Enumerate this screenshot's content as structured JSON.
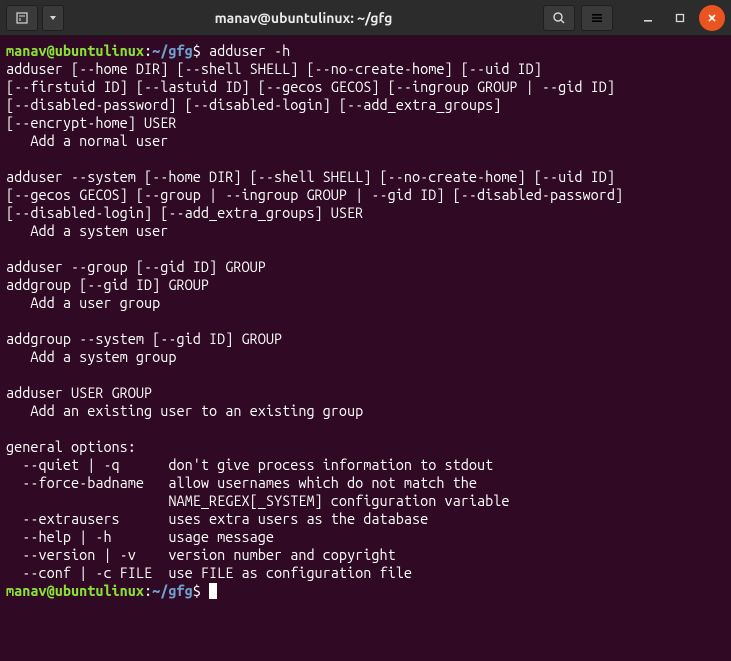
{
  "titlebar": {
    "title": "manav@ubuntulinux: ~/gfg"
  },
  "prompt": {
    "user": "manav@ubuntulinux",
    "sep": ":",
    "path": "~/gfg",
    "dollar": "$"
  },
  "command": "adduser -h",
  "output": [
    "adduser [--home DIR] [--shell SHELL] [--no-create-home] [--uid ID]",
    "[--firstuid ID] [--lastuid ID] [--gecos GECOS] [--ingroup GROUP | --gid ID]",
    "[--disabled-password] [--disabled-login] [--add_extra_groups]",
    "[--encrypt-home] USER",
    "   Add a normal user",
    "",
    "adduser --system [--home DIR] [--shell SHELL] [--no-create-home] [--uid ID]",
    "[--gecos GECOS] [--group | --ingroup GROUP | --gid ID] [--disabled-password]",
    "[--disabled-login] [--add_extra_groups] USER",
    "   Add a system user",
    "",
    "adduser --group [--gid ID] GROUP",
    "addgroup [--gid ID] GROUP",
    "   Add a user group",
    "",
    "addgroup --system [--gid ID] GROUP",
    "   Add a system group",
    "",
    "adduser USER GROUP",
    "   Add an existing user to an existing group",
    "",
    "general options:",
    "  --quiet | -q      don't give process information to stdout",
    "  --force-badname   allow usernames which do not match the",
    "                    NAME_REGEX[_SYSTEM] configuration variable",
    "  --extrausers      uses extra users as the database",
    "  --help | -h       usage message",
    "  --version | -v    version number and copyright",
    "  --conf | -c FILE  use FILE as configuration file"
  ]
}
